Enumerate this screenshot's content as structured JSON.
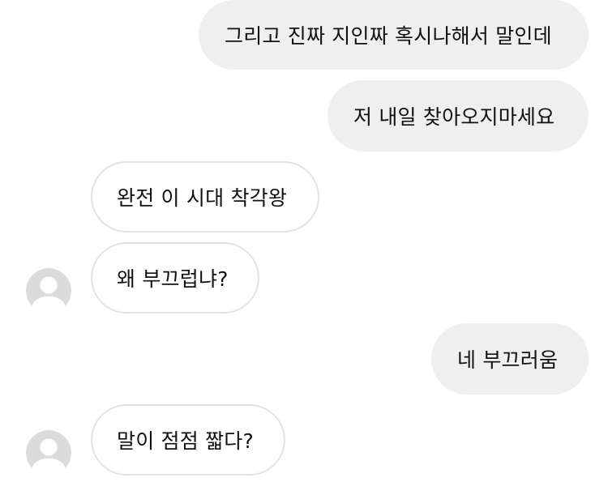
{
  "messages": [
    {
      "direction": "sent",
      "text": "그리고 진짜 지인짜 혹시나해서 말인데"
    },
    {
      "direction": "sent",
      "text": "저 내일 찾아오지마세요"
    },
    {
      "direction": "received",
      "text": "완전 이 시대 착각왕"
    },
    {
      "direction": "received",
      "text": "왜 부끄럽냐?"
    },
    {
      "direction": "sent",
      "text": "네 부끄러움"
    },
    {
      "direction": "received",
      "text": "말이 점점 짧다?"
    }
  ],
  "colors": {
    "sent_bubble": "#efefef",
    "received_border": "#e3e3e3",
    "avatar_bg": "#dbdbdb",
    "avatar_fg": "#ffffff"
  },
  "icons": {
    "avatar": "default-profile-avatar-icon"
  }
}
